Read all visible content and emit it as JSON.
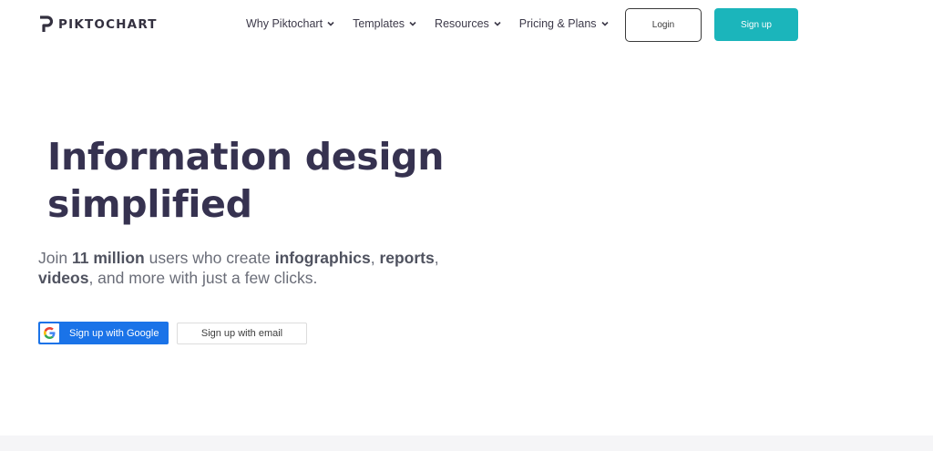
{
  "brand": {
    "name": "PIKTOCHART",
    "color": "#33303f"
  },
  "nav": {
    "items": [
      {
        "label": "Why Piktochart"
      },
      {
        "label": "Templates"
      },
      {
        "label": "Resources"
      },
      {
        "label": "Pricing & Plans"
      }
    ]
  },
  "auth": {
    "login_label": "Login",
    "signup_label": "Sign up",
    "signup_color": "#1bb5bb"
  },
  "hero": {
    "title_line1": "Information design",
    "title_line2": "simplified",
    "subtitle": {
      "p1": "Join ",
      "b1": "11 million",
      "p2": " users who create ",
      "b2": "infographics",
      "p3": ", ",
      "b3": "reports",
      "p4": ",",
      "b4": "videos",
      "p5": ", and more with just a few clicks."
    }
  },
  "cta": {
    "google_label": "Sign up with Google",
    "google_color": "#1a73e8",
    "email_label": "Sign up with email"
  }
}
